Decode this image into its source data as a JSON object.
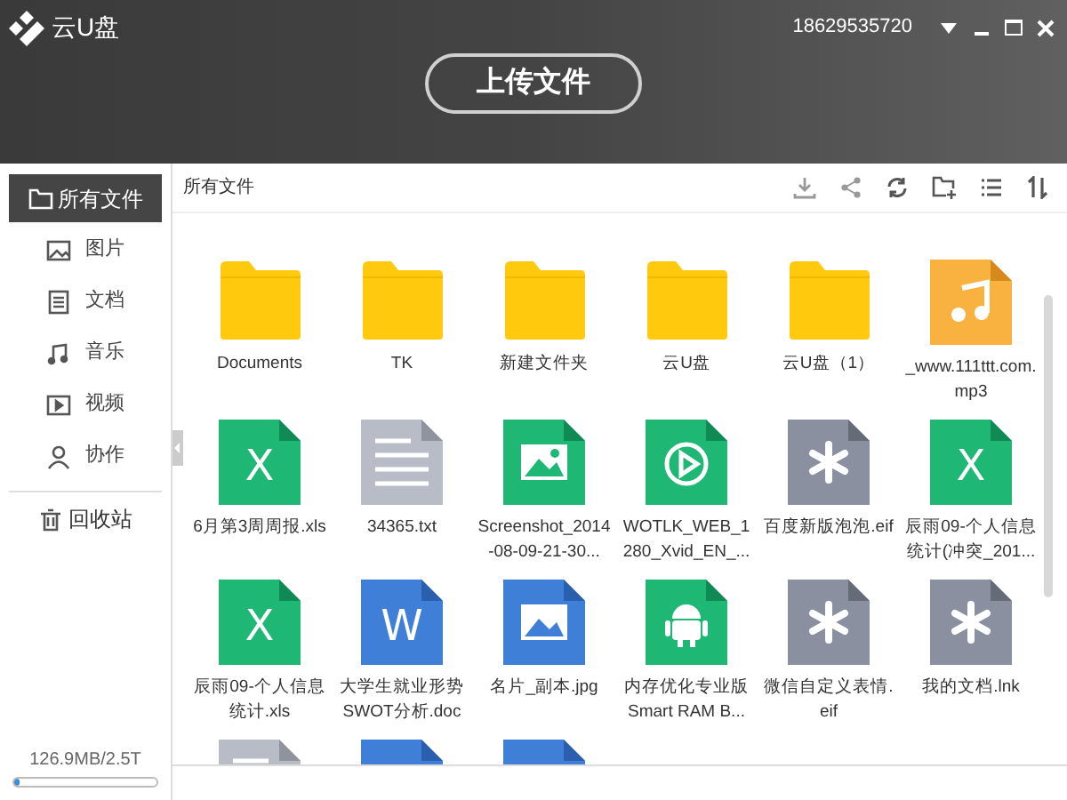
{
  "app": {
    "name": "云U盘",
    "account": "18629535720"
  },
  "upload_button": "上传文件",
  "sidebar": {
    "items": [
      {
        "label": "所有文件",
        "kind": "folder",
        "selected": true
      },
      {
        "label": "图片",
        "kind": "image",
        "selected": false
      },
      {
        "label": "文档",
        "kind": "doc",
        "selected": false
      },
      {
        "label": "音乐",
        "kind": "music",
        "selected": false
      },
      {
        "label": "视频",
        "kind": "video",
        "selected": false
      },
      {
        "label": "协作",
        "kind": "user",
        "selected": false
      }
    ],
    "trash": "回收站",
    "storage": {
      "reading": "126.9MB/2.5T",
      "level": 0.03
    }
  },
  "breadcrumb": "所有文件",
  "files": [
    {
      "kind": "folder",
      "label": "Documents"
    },
    {
      "kind": "folder",
      "label": "TK"
    },
    {
      "kind": "folder",
      "label": "新建文件夹"
    },
    {
      "kind": "folder",
      "label": "云U盘"
    },
    {
      "kind": "folder",
      "label": "云U盘（1）"
    },
    {
      "kind": "music",
      "label": "_www.111ttt.com.mp3"
    },
    {
      "kind": "excel",
      "glyph": "X",
      "label": "6月第3周周报.xls"
    },
    {
      "kind": "text",
      "label": "34365.txt"
    },
    {
      "kind": "image",
      "label": "Screenshot_2014-08-09-21-30..."
    },
    {
      "kind": "video",
      "label": "WOTLK_WEB_1280_Xvid_EN_..."
    },
    {
      "kind": "other",
      "label": "百度新版泡泡.eif"
    },
    {
      "kind": "excel",
      "glyph": "X",
      "label": "辰雨09-个人信息统计(冲突_201..."
    },
    {
      "kind": "excel",
      "glyph": "X",
      "label": "辰雨09-个人信息统计.xls"
    },
    {
      "kind": "word",
      "glyph": "W",
      "label": "大学生就业形势SWOT分析.doc"
    },
    {
      "kind": "picture",
      "label": "名片_副本.jpg"
    },
    {
      "kind": "android",
      "label": "内存优化专业版Smart RAM B..."
    },
    {
      "kind": "other",
      "label": "微信自定义表情.eif"
    },
    {
      "kind": "other",
      "label": "我的文档.lnk"
    },
    {
      "kind": "text"
    },
    {
      "kind": "word"
    },
    {
      "kind": "picture"
    }
  ]
}
